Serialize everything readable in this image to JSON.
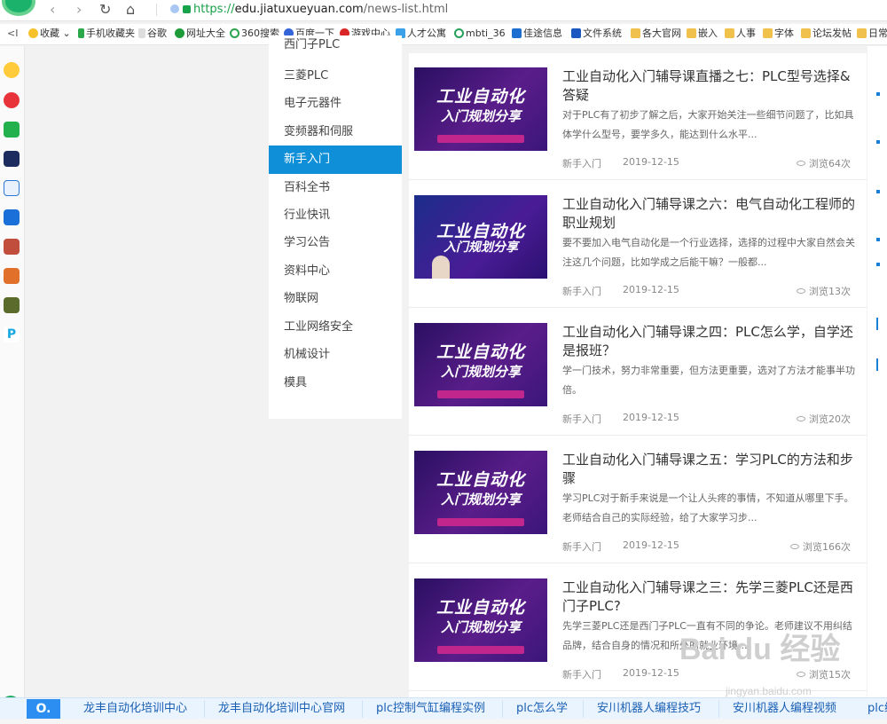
{
  "browser": {
    "url": {
      "proto": "https://",
      "host": "edu.jiatuxueyuan.com",
      "path": "/news-list.html"
    },
    "back_icon": "chevron-left-icon",
    "forward_icon": "chevron-right-icon",
    "refresh_icon": "refresh-icon",
    "home_icon": "home-icon"
  },
  "bookmarks": [
    {
      "label": "收藏"
    },
    {
      "label": "手机收藏夹"
    },
    {
      "label": "谷歌"
    },
    {
      "label": "网址大全"
    },
    {
      "label": "360搜索"
    },
    {
      "label": "百度一下"
    },
    {
      "label": "游戏中心"
    },
    {
      "label": "人才公寓"
    },
    {
      "label": "mbti_36"
    },
    {
      "label": "佳途信息"
    },
    {
      "label": "文件系统"
    },
    {
      "label": "各大官网"
    },
    {
      "label": "嵌入"
    },
    {
      "label": "人事"
    },
    {
      "label": "字体"
    },
    {
      "label": "论坛发帖"
    },
    {
      "label": "日常"
    }
  ],
  "categories": [
    {
      "label": "西门子PLC"
    },
    {
      "label": "三菱PLC"
    },
    {
      "label": "电子元器件"
    },
    {
      "label": "变频器和伺服"
    },
    {
      "label": "新手入门",
      "active": true
    },
    {
      "label": "百科全书"
    },
    {
      "label": "行业快讯"
    },
    {
      "label": "学习公告"
    },
    {
      "label": "资料中心"
    },
    {
      "label": "物联网"
    },
    {
      "label": "工业网络安全"
    },
    {
      "label": "机械设计"
    },
    {
      "label": "模具"
    }
  ],
  "thumb_text": {
    "line1": "工业自动化",
    "line2": "入门规划分享"
  },
  "news": [
    {
      "title": "工业自动化入门辅导课直播之七：PLC型号选择&答疑",
      "desc": "对于PLC有了初步了解之后，大家开始关注一些细节问题了，比如具体学什么型号，要学多久，能达到什么水平...",
      "category": "新手入门",
      "date": "2019-12-15",
      "views": "浏览64次"
    },
    {
      "title": "工业自动化入门辅导课之六：电气自动化工程师的职业规划",
      "desc": "要不要加入电气自动化是一个行业选择，选择的过程中大家自然会关注这几个问题，比如学成之后能干嘛？一般都...",
      "category": "新手入门",
      "date": "2019-12-15",
      "views": "浏览13次"
    },
    {
      "title": "工业自动化入门辅导课之四：PLC怎么学，自学还是报班？",
      "desc": "学一门技术，努力非常重要，但方法更重要，选对了方法才能事半功倍。",
      "category": "新手入门",
      "date": "2019-12-15",
      "views": "浏览20次"
    },
    {
      "title": "工业自动化入门辅导课之五：学习PLC的方法和步骤",
      "desc": "学习PLC对于新手来说是一个让人头疼的事情，不知道从哪里下手。老师结合自己的实际经验，给了大家学习步...",
      "category": "新手入门",
      "date": "2019-12-15",
      "views": "浏览166次"
    },
    {
      "title": "工业自动化入门辅导课之三：先学三菱PLC还是西门子PLC?",
      "desc": "先学三菱PLC还是西门子PLC一直有不同的争论。老师建议不用纠结品牌，结合自身的情况和所处的就业环境...",
      "category": "新手入门",
      "date": "2019-12-15",
      "views": "浏览15次"
    }
  ],
  "bottom_bar": {
    "logo": "O.",
    "items": [
      {
        "label": "龙丰自动化培训中心"
      },
      {
        "label": "龙丰自动化培训中心官网"
      },
      {
        "label": "plc控制气缸编程实例"
      },
      {
        "label": "plc怎么学"
      },
      {
        "label": "安川机器人编程技巧"
      },
      {
        "label": "安川机器人编程视频"
      },
      {
        "label": "plc编"
      }
    ]
  },
  "watermark": {
    "text": "Bai du 经验",
    "sub": "jingyan.baidu.com"
  },
  "colors": {
    "accent": "#0f8fd8",
    "link": "#1a5fb4",
    "ssl": "#19a04a"
  }
}
